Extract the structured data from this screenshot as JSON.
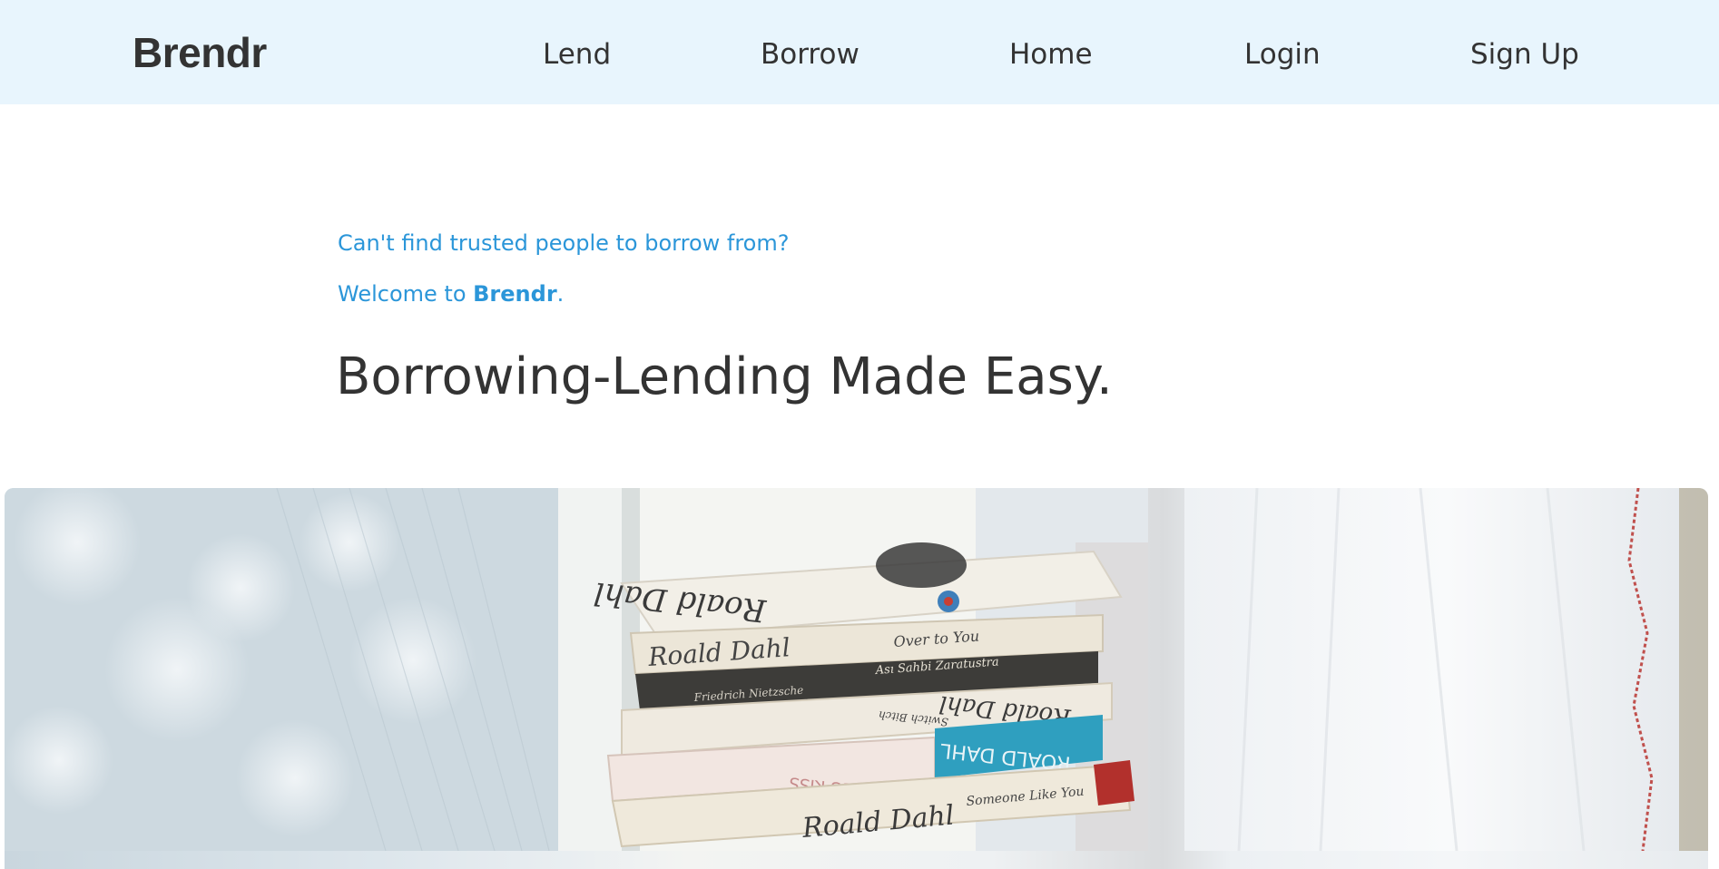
{
  "nav": {
    "brand": "Brendr",
    "links": [
      "Lend",
      "Borrow",
      "Home",
      "Login",
      "Sign Up"
    ]
  },
  "hero": {
    "tagline": "Can't find trusted people to borrow from?",
    "welcome_prefix": "Welcome to ",
    "welcome_brand": "Brendr",
    "welcome_suffix": ".",
    "headline": "Borrowing-Lending Made Easy."
  },
  "photo": {
    "book_spines": [
      "Roald Dahl",
      "Over to You",
      "Ası Sahbi Zaratustra",
      "Friedrich Nietzsche",
      "Roald Dahl",
      "Switch Bitch",
      "ROALD DAHL",
      "KISS KISS",
      "Roald Dahl",
      "Someone Like You"
    ]
  },
  "colors": {
    "navbar_bg": "#e8f5fd",
    "accent": "#2b96d9",
    "text": "#333333"
  }
}
